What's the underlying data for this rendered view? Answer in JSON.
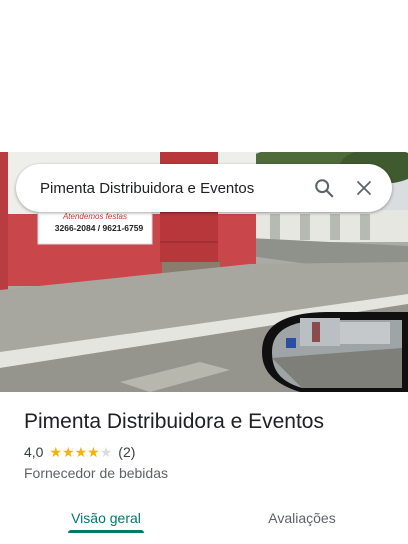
{
  "search": {
    "query": "Pimenta Distribuidora e Eventos",
    "search_icon": "search-icon",
    "close_icon": "close-icon"
  },
  "photo": {
    "sign_line1": "Atendemos festas",
    "sign_line2": "3266-2084 / 9621-6759"
  },
  "place": {
    "title": "Pimenta Distribuidora e Eventos",
    "rating": "4,0",
    "stars": 4,
    "stars_max": 5,
    "review_count": "(2)",
    "category": "Fornecedor de bebidas"
  },
  "tabs": [
    {
      "label": "Visão geral",
      "active": true
    },
    {
      "label": "Avaliações",
      "active": false
    }
  ],
  "colors": {
    "accent": "#00796b",
    "star": "#f4b400",
    "star_empty": "#dadce0"
  }
}
